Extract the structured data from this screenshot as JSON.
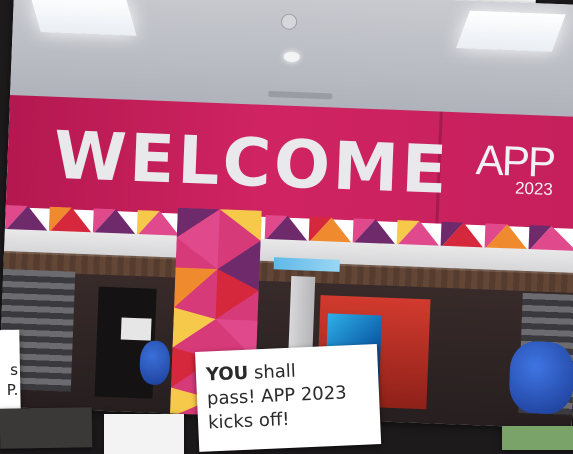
{
  "banner": {
    "welcome": "WELCOME",
    "logo_word": "APP",
    "logo_year": "2023"
  },
  "caption": {
    "bold": "YOU",
    "rest_line1": " shall",
    "line2": "pass! APP 2023",
    "line3": "kicks off!"
  },
  "left_card": {
    "line1": "s",
    "line2": "P."
  },
  "colors": {
    "banner_magenta": "#c51f5c",
    "triangle_pink": "#e04a8c",
    "triangle_purple": "#6e2a6b",
    "triangle_orange": "#f08a2e",
    "triangle_yellow": "#f6c94a",
    "triangle_red": "#d6283c"
  }
}
